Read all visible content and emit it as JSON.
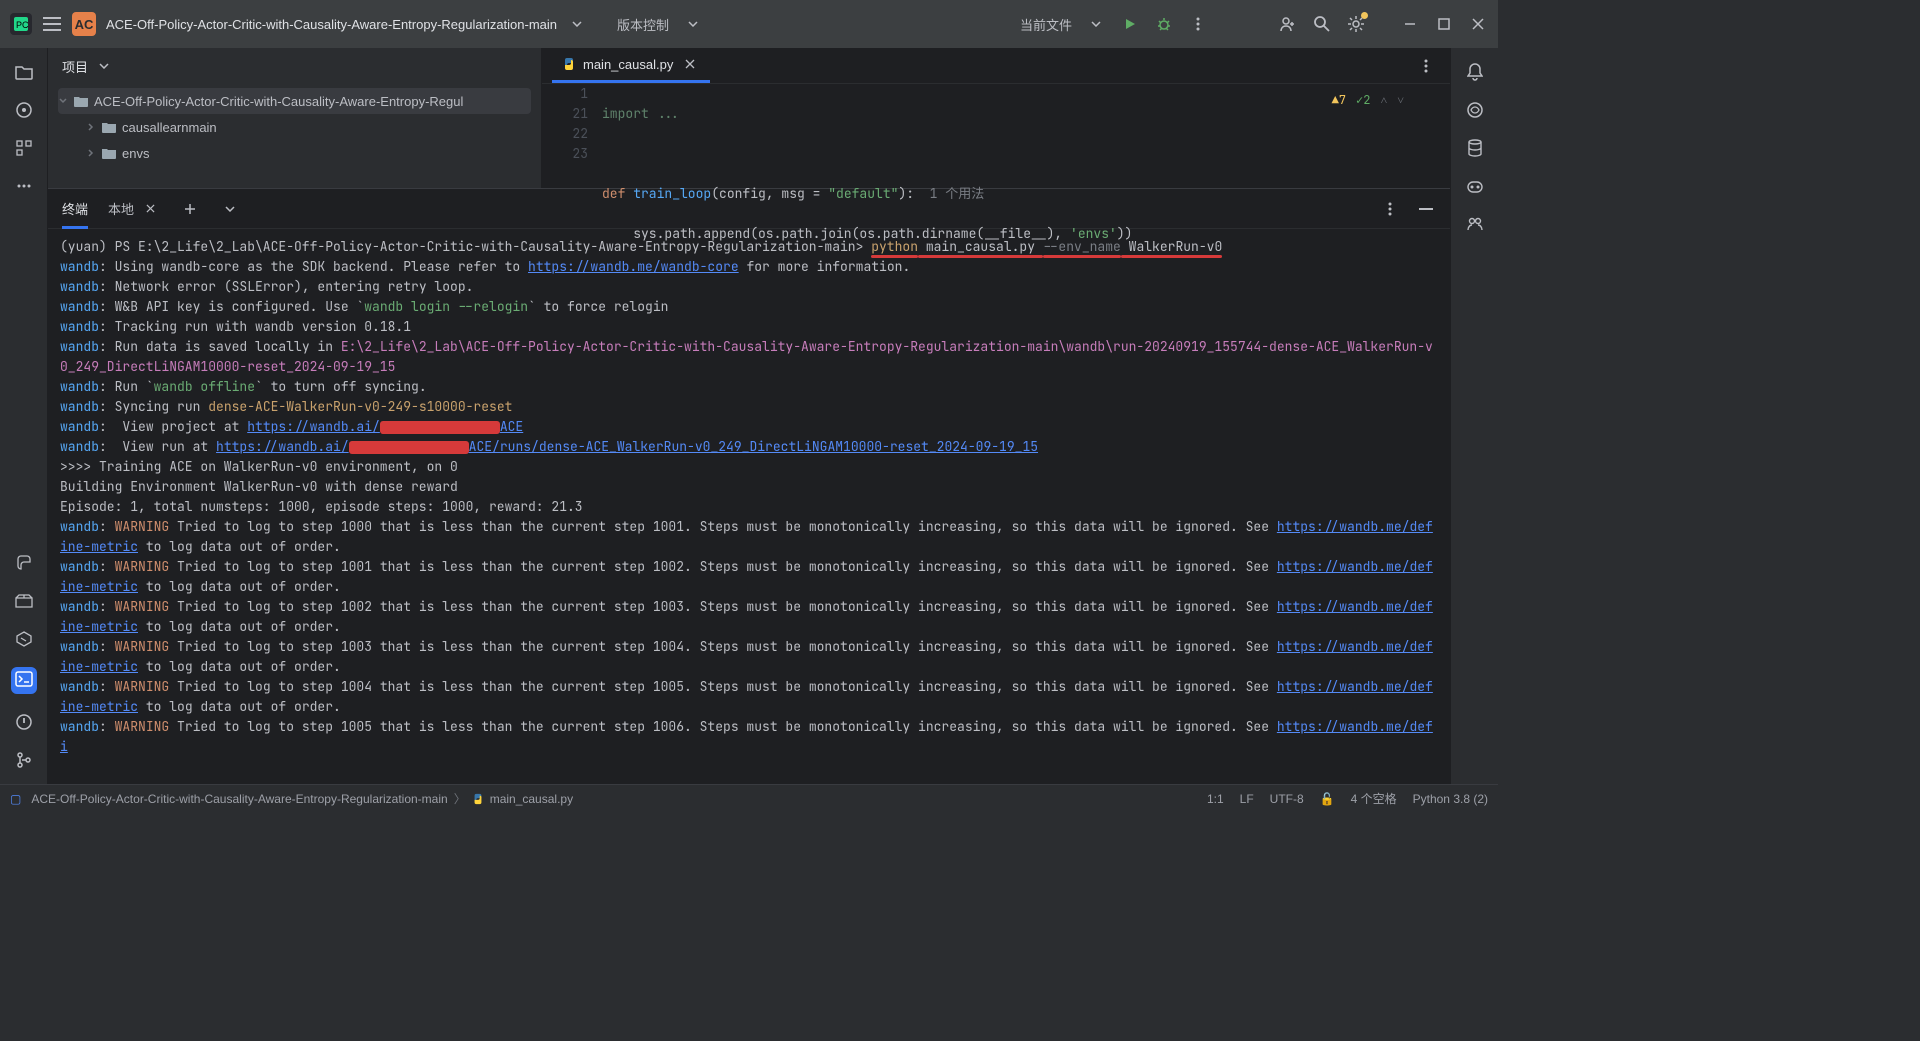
{
  "titlebar": {
    "project_badge": "AC",
    "project_name": "ACE-Off-Policy-Actor-Critic-with-Causality-Aware-Entropy-Regularization-main",
    "vcs_label": "版本控制",
    "current_file_label": "当前文件"
  },
  "project_panel": {
    "title": "项目",
    "root": "ACE-Off-Policy-Actor-Critic-with-Causality-Aware-Entropy-Regul",
    "child1": "causallearnmain",
    "child2": "envs"
  },
  "editor": {
    "tab_name": "main_causal.py",
    "line_nums": [
      "1",
      "21",
      "22",
      "23"
    ],
    "line1": "import ...",
    "line22_def": "def ",
    "line22_fn": "train_loop",
    "line22_sig": "(config, msg = ",
    "line22_str": "\"default\"",
    "line22_close": "):",
    "line22_usage": "  1 个用法",
    "line23_a": "    sys.path.append(os.path.join(os.path.dirname(__file__), ",
    "line23_b": "'envs'",
    "line23_c": "))",
    "ann_warn": "7",
    "ann_ok": "2"
  },
  "terminal": {
    "tab_label": "终端",
    "subtab_label": "本地",
    "prompt_prefix": "(yuan) PS E:\\2_Life\\2_Lab\\ACE-Off-Policy-Actor-Critic-with-Causality-Aware-Entropy-Regularization-main> ",
    "cmd_python": "python",
    "cmd_script": " main_causal.py ",
    "cmd_flag": "--env_name",
    "cmd_arg": " WalkerRun-v0",
    "l_using": ": Using wandb-core as the SDK backend. Please refer to ",
    "link_core": "https://wandb.me/wandb-core",
    "l_using2": " for more information.",
    "l_ssl": ": Network error (SSLError), entering retry loop.",
    "l_api": ": W&B API key is configured. Use `",
    "l_api_cmd": "wandb login --relogin",
    "l_api2": "` to force relogin",
    "l_track": ": Tracking run with wandb version 0.18.1",
    "l_saved": ": Run data is saved locally in ",
    "saved_path": "E:\\2_Life\\2_Lab\\ACE-Off-Policy-Actor-Critic-with-Causality-Aware-Entropy-Regularization-main\\wandb\\run-20240919_155744-dense-ACE_WalkerRun-v0_249_DirectLiNGAM10000-reset_2024-09-19_15",
    "l_offline": ": Run `",
    "l_offline_cmd": "wandb offline",
    "l_offline2": "` to turn off syncing.",
    "l_sync": ": Syncing run ",
    "sync_name": "dense-ACE-WalkerRun-v0-249-s10000-reset",
    "l_viewproj": ":  View project at ",
    "viewproj_link": "https://wandb.ai/",
    "viewproj_suffix": "ACE",
    "l_viewrun": ":  View run at ",
    "viewrun_link": "https://wandb.ai/",
    "viewrun_suffix": "ACE/runs/dense-ACE_WalkerRun-v0_249_DirectLiNGAM10000-reset_2024-09-19_15",
    "train_header": ">>>> Training ACE on WalkerRun-v0 environment, on 0",
    "build_env": "Building Environment WalkerRun-v0 with dense reward",
    "episode": "Episode: 1, total numsteps: 1000, episode steps: 1000, reward: 21.3",
    "warn_label": "WARNING",
    "warn_msgs": [
      " Tried to log to step 1000 that is less than the current step 1001. Steps must be monotonically increasing, so this data will be ignored. See ",
      " Tried to log to step 1001 that is less than the current step 1002. Steps must be monotonically increasing, so this data will be ignored. See ",
      " Tried to log to step 1002 that is less than the current step 1003. Steps must be monotonically increasing, so this data will be ignored. See ",
      " Tried to log to step 1003 that is less than the current step 1004. Steps must be monotonically increasing, so this data will be ignored. See ",
      " Tried to log to step 1004 that is less than the current step 1005. Steps must be monotonically increasing, so this data will be ignored. See ",
      " Tried to log to step 1005 that is less than the current step 1006. Steps must be monotonically increasing, so this data will be ignored. See "
    ],
    "defi_link": "https://wandb.me/define-metric",
    "warn_tail": " to log data out of order."
  },
  "statusbar": {
    "crumb1": "ACE-Off-Policy-Actor-Critic-with-Causality-Aware-Entropy-Regularization-main",
    "crumb2": "main_causal.py",
    "pos": "1:1",
    "lf": "LF",
    "enc": "UTF-8",
    "indent": "4 个空格",
    "py": "Python 3.8 (2)"
  }
}
